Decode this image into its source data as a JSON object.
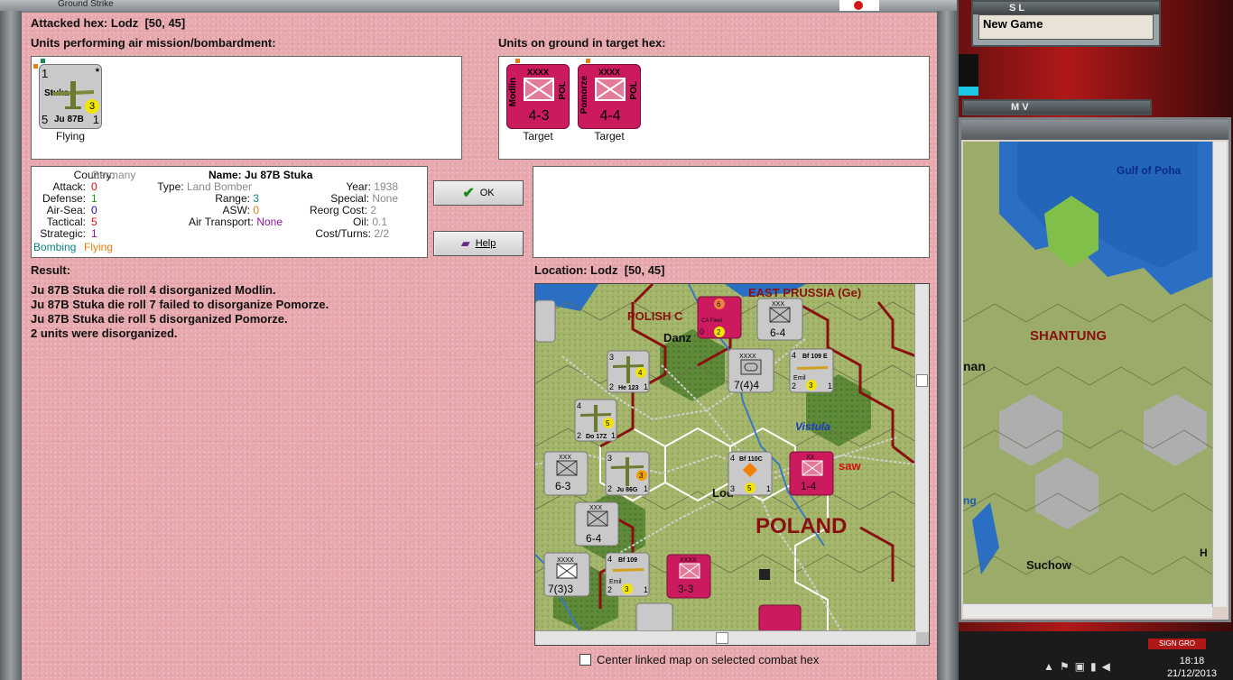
{
  "window": {
    "title": "Ground Strike"
  },
  "attacked_hex": {
    "label": "Attacked hex:",
    "name": "Lodz",
    "coords": "[50, 45]"
  },
  "air_units": {
    "header": "Units performing air mission/bombardment:",
    "units": [
      {
        "name": "Stuka",
        "model": "Ju 87B",
        "top_left": "1",
        "top_right": "*",
        "left_value": "5",
        "right_value": "1",
        "badge": "3",
        "caption": "Flying"
      }
    ]
  },
  "ground_units": {
    "header": "Units on ground in target hex:",
    "units": [
      {
        "side": "Modlin",
        "size": "XXXX",
        "nation": "POL",
        "strength": "4-3",
        "caption": "Target"
      },
      {
        "side": "Pomorze",
        "size": "XXXX",
        "nation": "POL",
        "strength": "4-4",
        "caption": "Target"
      }
    ]
  },
  "stats": {
    "country": {
      "label": "Country:",
      "value": "Germany"
    },
    "attack": {
      "label": "Attack:",
      "value": "0"
    },
    "defense": {
      "label": "Defense:",
      "value": "1"
    },
    "air_sea": {
      "label": "Air-Sea:",
      "value": "0"
    },
    "tactical": {
      "label": "Tactical:",
      "value": "5"
    },
    "strategic": {
      "label": "Strategic:",
      "value": "1"
    },
    "tags": [
      "Bombing",
      "Flying"
    ],
    "name": {
      "label": "Name:",
      "value": "Ju 87B Stuka"
    },
    "type": {
      "label": "Type:",
      "value": "Land Bomber"
    },
    "year": {
      "label": "Year:",
      "value": "1938"
    },
    "range": {
      "label": "Range:",
      "value": "3"
    },
    "special": {
      "label": "Special:",
      "value": "None"
    },
    "asw": {
      "label": "ASW:",
      "value": "0"
    },
    "reorg_cost": {
      "label": "Reorg Cost:",
      "value": "2"
    },
    "oil": {
      "label": "Oil:",
      "value": "0.1"
    },
    "air_transport": {
      "label": "Air Transport:",
      "value": "None"
    },
    "cost_turns": {
      "label": "Cost/Turns:",
      "value": "2/2"
    }
  },
  "buttons": {
    "ok": "OK",
    "help": "Help"
  },
  "result": {
    "header": "Result:",
    "lines": [
      "Ju 87B Stuka die roll 4 disorganized Modlin.",
      "Ju 87B Stuka die roll 7 failed to disorganize Pomorze.",
      "Ju 87B Stuka die roll 5 disorganized Pomorze.",
      "2 units were disorganized."
    ]
  },
  "location": {
    "label": "Location:",
    "name": "Lodz",
    "coords": "[50, 45]"
  },
  "map": {
    "labels": {
      "east_prussia": "EAST PRUSSIA (Ge)",
      "polish_corridor": "POLISH C",
      "danzig": "Danz",
      "vistula": "Vistula",
      "warsaw": "saw",
      "lodz": "Lod",
      "poland": "POLAND"
    },
    "counters": [
      {
        "id": "he123",
        "model": "He 123",
        "top": "3",
        "v1": "2",
        "v2": "1",
        "badge": "4"
      },
      {
        "id": "do17z",
        "model": "Do 17Z",
        "top": "4",
        "v1": "2",
        "v2": "1",
        "badge": "5"
      },
      {
        "id": "ju86g",
        "model": "Ju 86G",
        "top": "3",
        "v1": "2",
        "v2": "1",
        "badge": "3"
      },
      {
        "id": "bf109_a",
        "model": "Bf 109 E",
        "top": "4",
        "v1": "2",
        "v2": "1",
        "badge": "3",
        "label": "Emil"
      },
      {
        "id": "bf109_b",
        "model": "Bf 109",
        "top": "4",
        "v1": "2",
        "v2": "1",
        "badge": "3",
        "label": "Emil"
      },
      {
        "id": "bf110c",
        "model": "Bf 110C",
        "top": "4",
        "v1": "3",
        "v2": "1",
        "badge": "5"
      },
      {
        "id": "xiv_inf",
        "size": "XXX",
        "strength": "6-3"
      },
      {
        "id": "iii_inf",
        "size": "XXX",
        "strength": "6-4"
      },
      {
        "id": "iii_inf_b",
        "size": "XXX",
        "strength": "6-4"
      },
      {
        "id": "armor",
        "size": "XXXX",
        "strength": "7(4)4"
      },
      {
        "id": "armor_b",
        "size": "XXXX",
        "strength": "7(3)3"
      },
      {
        "id": "pol_ab",
        "size": "XX",
        "strength": "1-4"
      },
      {
        "id": "pol_b",
        "size": "XXXX",
        "strength": "3-3"
      },
      {
        "id": "pol_fleet",
        "size": "",
        "strength": "6",
        "note": "CA Fleet",
        "v1": "0",
        "v2": "2"
      }
    ]
  },
  "center_checkbox": {
    "label": "Center linked map on selected combat hex",
    "checked": false
  },
  "background": {
    "panel_sl_title": "S L",
    "panel_sl_text": "New Game",
    "panel_mv_title": "M V",
    "map_labels": {
      "gulf": "Gulf of Poha",
      "shantung": "SHANTUNG",
      "nan": "nan",
      "suchow": "Suchow",
      "ng": "ng",
      "h": "H"
    },
    "taskbar_tag": "SIGN GRO",
    "clock_time": "18:18",
    "clock_date": "21/12/2013"
  },
  "colors": {
    "dialog_bg": "#e7a9ad",
    "polish": "#cc1a5e",
    "german": "#c9c9c9",
    "border_red": "#8a1010"
  }
}
